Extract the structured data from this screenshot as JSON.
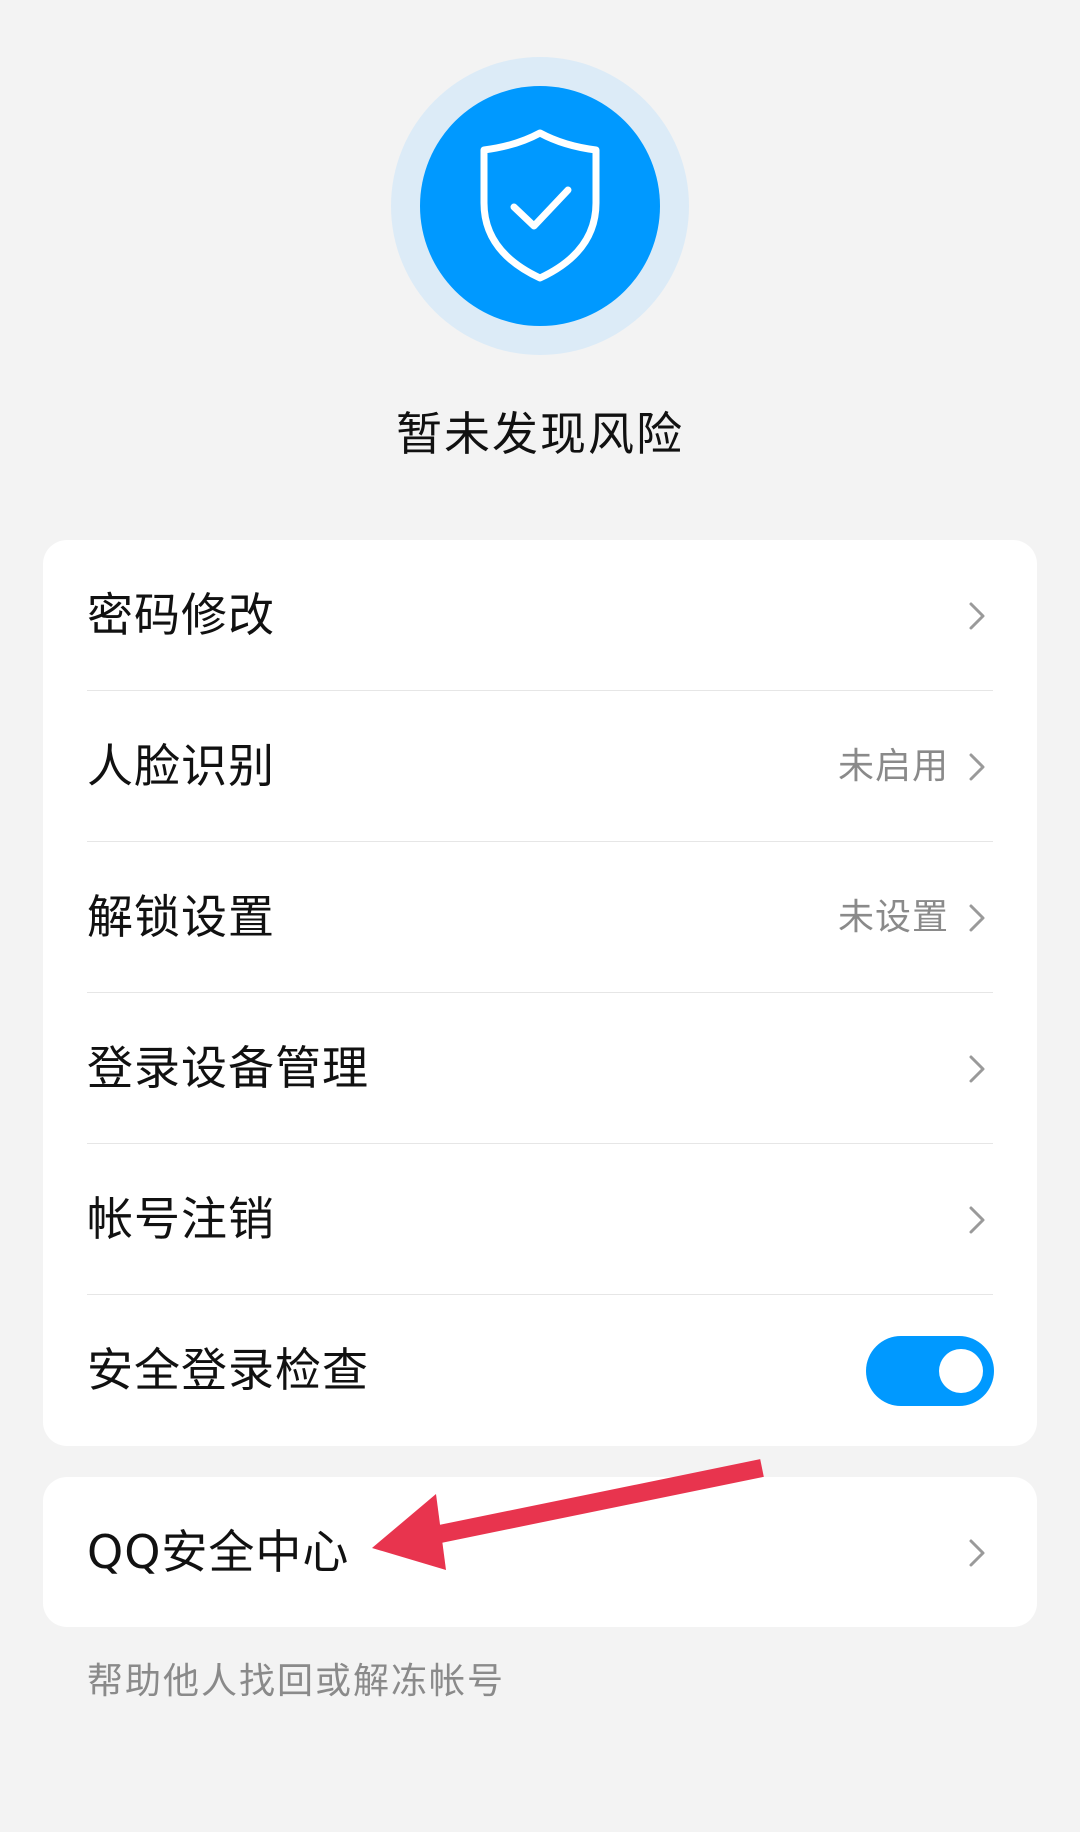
{
  "status": {
    "icon": "shield-check-icon",
    "text": "暂未发现风险"
  },
  "settings": [
    {
      "label": "密码修改",
      "value": ""
    },
    {
      "label": "人脸识别",
      "value": "未启用"
    },
    {
      "label": "解锁设置",
      "value": "未设置"
    },
    {
      "label": "登录设备管理",
      "value": ""
    },
    {
      "label": "帐号注销",
      "value": ""
    },
    {
      "label": "安全登录检查",
      "toggle": true
    }
  ],
  "qq_security": {
    "label": "QQ安全中心"
  },
  "footer": {
    "help_text": "帮助他人找回或解冻帐号"
  },
  "colors": {
    "accent": "#0099ff",
    "annotation_arrow": "#e8344e"
  }
}
